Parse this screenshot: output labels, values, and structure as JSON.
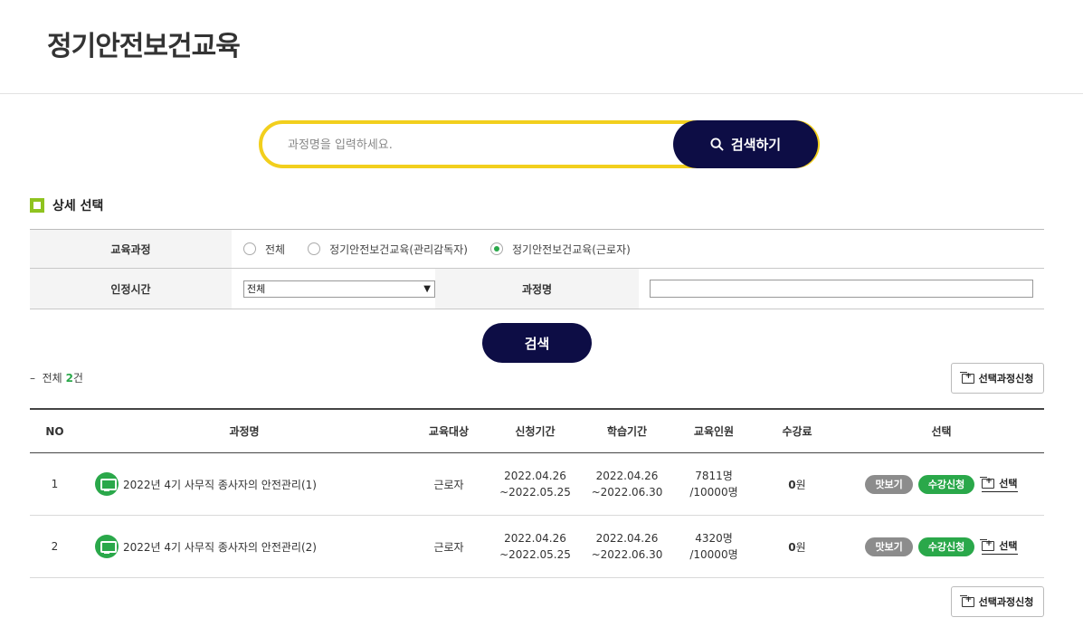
{
  "page": {
    "title": "정기안전보건교육"
  },
  "search": {
    "placeholder": "과정명을 입력하세요.",
    "button_label": "검색하기"
  },
  "detail": {
    "title": "상세 선택",
    "course_label": "교육과정",
    "radios": [
      {
        "label": "전체",
        "checked": false
      },
      {
        "label": "정기안전보건교육(관리감독자)",
        "checked": false
      },
      {
        "label": "정기안전보건교육(근로자)",
        "checked": true
      }
    ],
    "hours_label": "인정시간",
    "hours_selected": "전체",
    "name_label": "과정명",
    "submit_label": "검색"
  },
  "results": {
    "total_prefix": "전체",
    "total_count": "2",
    "total_suffix": "건",
    "apply_selected_label": "선택과정신청",
    "columns": [
      "NO",
      "과정명",
      "교육대상",
      "신청기간",
      "학습기간",
      "교육인원",
      "수강료",
      "선택"
    ],
    "rows": [
      {
        "no": "1",
        "name": "2022년 4기 사무직 종사자의 안전관리(1)",
        "target": "근로자",
        "apply_start": "2022.04.26",
        "apply_end": "~2022.05.25",
        "learn_start": "2022.04.26",
        "learn_end": "~2022.06.30",
        "count": "7811명",
        "capacity": "/10000명",
        "fee_value": "0",
        "fee_unit": "원",
        "preview_label": "맛보기",
        "enroll_label": "수강신청",
        "select_label": "선택"
      },
      {
        "no": "2",
        "name": "2022년 4기 사무직 종사자의 안전관리(2)",
        "target": "근로자",
        "apply_start": "2022.04.26",
        "apply_end": "~2022.05.25",
        "learn_start": "2022.04.26",
        "learn_end": "~2022.06.30",
        "count": "4320명",
        "capacity": "/10000명",
        "fee_value": "0",
        "fee_unit": "원",
        "preview_label": "맛보기",
        "enroll_label": "수강신청",
        "select_label": "선택"
      }
    ]
  },
  "colors": {
    "navy": "#0d0d45",
    "yellow": "#f2cf1d",
    "green": "#2aa84a",
    "gray_pill": "#8c8c8c"
  }
}
